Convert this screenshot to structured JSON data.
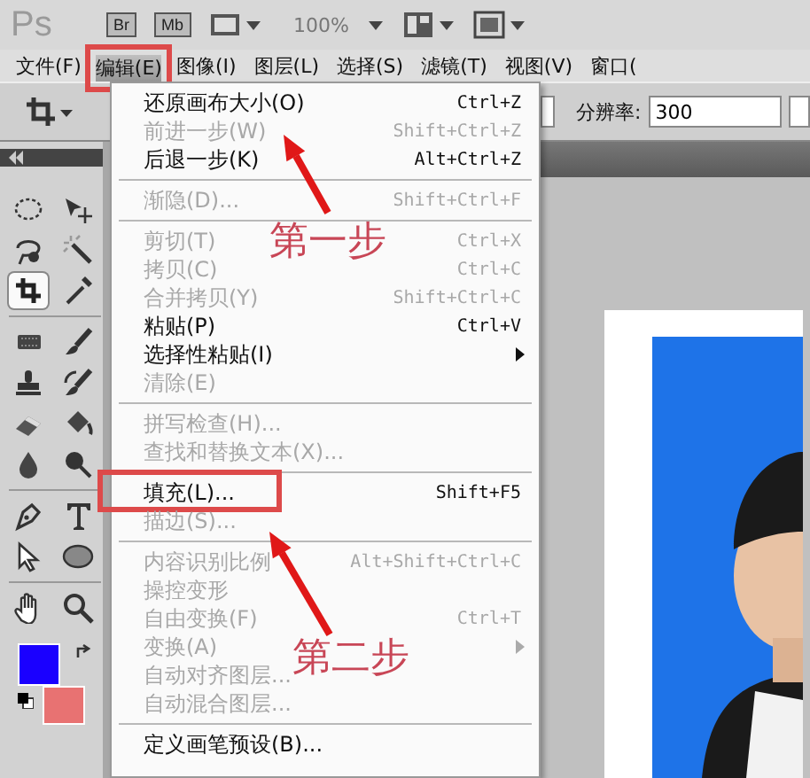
{
  "app_bar": {
    "logo": "Ps",
    "buttons": [
      {
        "label": "Br"
      },
      {
        "label": "Mb"
      }
    ],
    "zoom": "100%"
  },
  "menu_bar": [
    {
      "label": "文件(F)",
      "selected": false
    },
    {
      "label": "编辑(E)",
      "selected": true,
      "framed": true
    },
    {
      "label": "图像(I)",
      "selected": false
    },
    {
      "label": "图层(L)",
      "selected": false
    },
    {
      "label": "选择(S)",
      "selected": false
    },
    {
      "label": "滤镜(T)",
      "selected": false
    },
    {
      "label": "视图(V)",
      "selected": false
    },
    {
      "label": "窗口(",
      "selected": false
    }
  ],
  "options_bar": {
    "resolution_label": "分辨率:",
    "resolution_value": "300"
  },
  "menu": [
    {
      "kind": "item",
      "label": "还原画布大小(O)",
      "shortcut": "Ctrl+Z",
      "disabled": false
    },
    {
      "kind": "item",
      "label": "前进一步(W)",
      "shortcut": "Shift+Ctrl+Z",
      "disabled": true
    },
    {
      "kind": "item",
      "label": "后退一步(K)",
      "shortcut": "Alt+Ctrl+Z",
      "disabled": false
    },
    {
      "kind": "separator"
    },
    {
      "kind": "item",
      "label": "渐隐(D)...",
      "shortcut": "Shift+Ctrl+F",
      "disabled": true
    },
    {
      "kind": "separator"
    },
    {
      "kind": "item",
      "label": "剪切(T)",
      "shortcut": "Ctrl+X",
      "disabled": true
    },
    {
      "kind": "item",
      "label": "拷贝(C)",
      "shortcut": "Ctrl+C",
      "disabled": true
    },
    {
      "kind": "item",
      "label": "合并拷贝(Y)",
      "shortcut": "Shift+Ctrl+C",
      "disabled": true
    },
    {
      "kind": "item",
      "label": "粘贴(P)",
      "shortcut": "Ctrl+V",
      "disabled": false
    },
    {
      "kind": "item",
      "label": "选择性粘贴(I)",
      "submenu": true,
      "disabled": false
    },
    {
      "kind": "item",
      "label": "清除(E)",
      "disabled": true
    },
    {
      "kind": "separator"
    },
    {
      "kind": "item",
      "label": "拼写检查(H)...",
      "disabled": true
    },
    {
      "kind": "item",
      "label": "查找和替换文本(X)...",
      "disabled": true
    },
    {
      "kind": "separator"
    },
    {
      "kind": "item",
      "label": "填充(L)...",
      "shortcut": "Shift+F5",
      "disabled": false,
      "framed": true
    },
    {
      "kind": "item",
      "label": "描边(S)...",
      "disabled": true
    },
    {
      "kind": "separator"
    },
    {
      "kind": "item",
      "label": "内容识别比例",
      "shortcut": "Alt+Shift+Ctrl+C",
      "disabled": true
    },
    {
      "kind": "item",
      "label": "操控变形",
      "disabled": true
    },
    {
      "kind": "item",
      "label": "自由变换(F)",
      "shortcut": "Ctrl+T",
      "disabled": true
    },
    {
      "kind": "item",
      "label": "变换(A)",
      "submenu": true,
      "disabled": true
    },
    {
      "kind": "item",
      "label": "自动对齐图层...",
      "disabled": true
    },
    {
      "kind": "item",
      "label": "自动混合图层...",
      "disabled": true
    },
    {
      "kind": "separator"
    },
    {
      "kind": "item",
      "label": "定义画笔预设(B)...",
      "disabled": false
    }
  ],
  "tools": [
    {
      "kind": "marquee",
      "selected": false
    },
    {
      "kind": "move",
      "selected": false
    },
    {
      "kind": "lasso",
      "selected": false
    },
    {
      "kind": "wand",
      "selected": false
    },
    {
      "kind": "crop",
      "selected": true
    },
    {
      "kind": "eyedropper",
      "selected": false
    },
    {
      "kind": "separator"
    },
    {
      "kind": "patch",
      "selected": false
    },
    {
      "kind": "brush",
      "selected": false
    },
    {
      "kind": "stamp",
      "selected": false
    },
    {
      "kind": "history",
      "selected": false
    },
    {
      "kind": "eraser",
      "selected": false
    },
    {
      "kind": "bucket",
      "selected": false
    },
    {
      "kind": "blur",
      "selected": false
    },
    {
      "kind": "dodge",
      "selected": false
    },
    {
      "kind": "separator"
    },
    {
      "kind": "pen",
      "selected": false
    },
    {
      "kind": "type",
      "selected": false
    },
    {
      "kind": "select",
      "selected": false
    },
    {
      "kind": "ellipse",
      "selected": false
    },
    {
      "kind": "separator"
    },
    {
      "kind": "hand",
      "selected": false
    },
    {
      "kind": "zoom",
      "selected": false
    }
  ],
  "swatches": [
    {
      "color": "#1a00ff"
    },
    {
      "color": "#e87272"
    }
  ],
  "annotations": [
    {
      "text": "第一步"
    },
    {
      "text": "第二步"
    }
  ]
}
